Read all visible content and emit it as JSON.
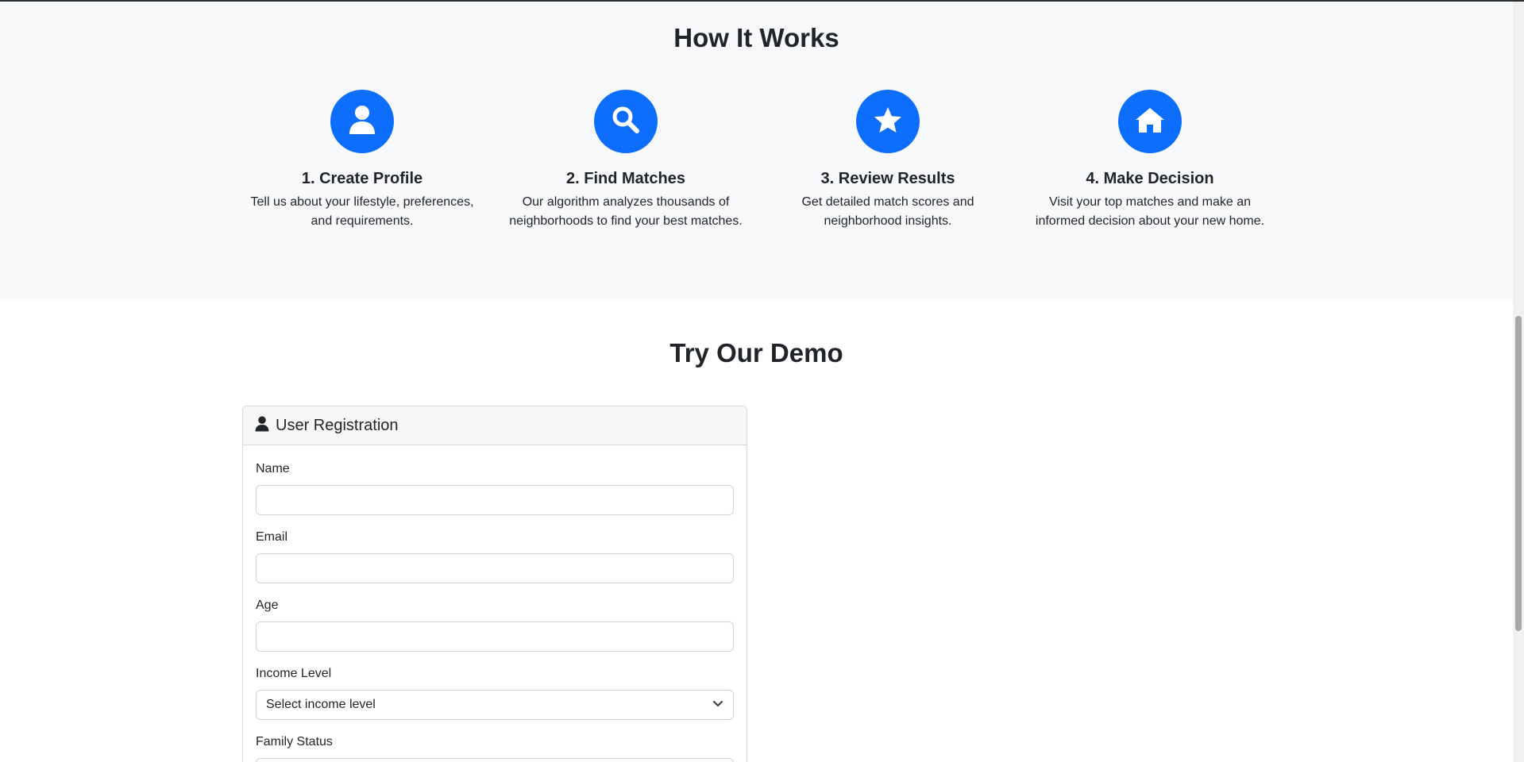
{
  "how_it_works": {
    "title": "How It Works",
    "steps": [
      {
        "icon": "user-icon",
        "title": "1. Create Profile",
        "text": "Tell us about your lifestyle, preferences, and requirements."
      },
      {
        "icon": "search-icon",
        "title": "2. Find Matches",
        "text": "Our algorithm analyzes thousands of neighborhoods to find your best matches."
      },
      {
        "icon": "star-icon",
        "title": "3. Review Results",
        "text": "Get detailed match scores and neighborhood insights."
      },
      {
        "icon": "home-icon",
        "title": "4. Make Decision",
        "text": "Visit your top matches and make an informed decision about your new home."
      }
    ]
  },
  "demo": {
    "title": "Try Our Demo",
    "form": {
      "header": "User Registration",
      "name_label": "Name",
      "name_value": "",
      "email_label": "Email",
      "email_value": "",
      "age_label": "Age",
      "age_value": "",
      "income_label": "Income Level",
      "income_selected": "Select income level",
      "family_label": "Family Status"
    }
  },
  "colors": {
    "accent": "#0d6efd",
    "section_bg": "#f8f9fa",
    "text": "#212529"
  }
}
